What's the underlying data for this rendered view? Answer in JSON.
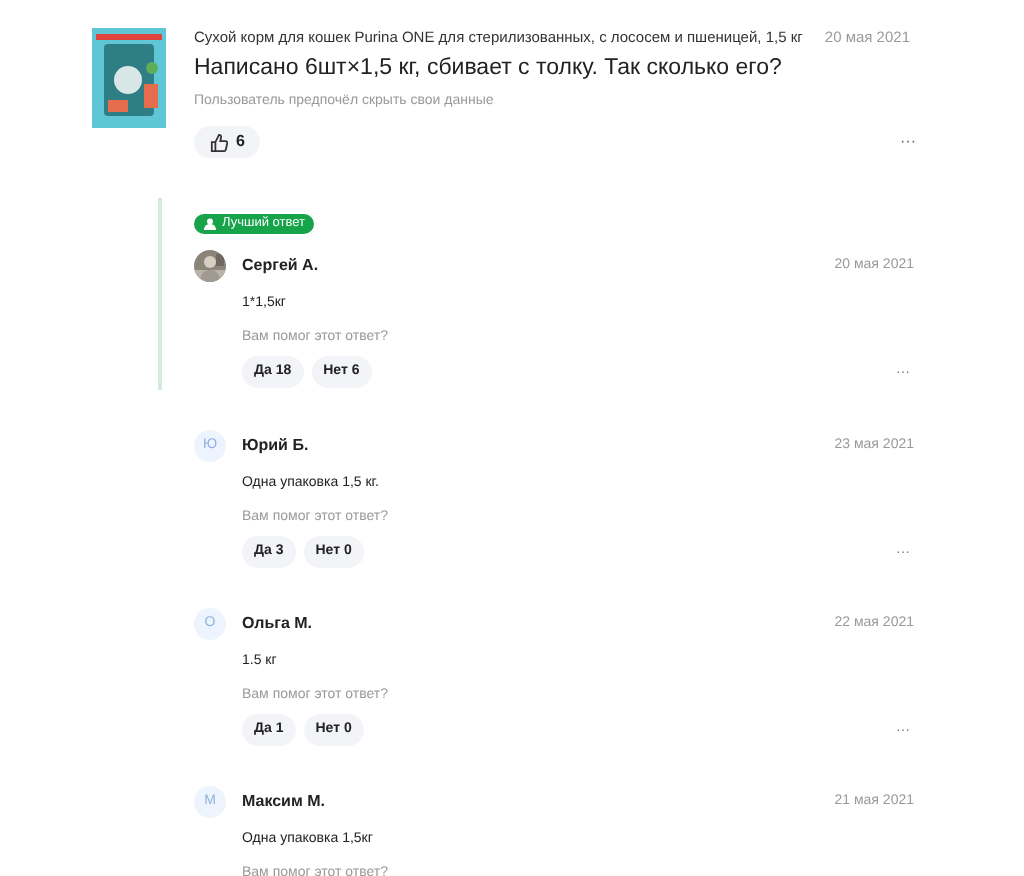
{
  "question": {
    "product": "Сухой корм для кошек Purina ONE для стерилизованных, с лососем и пшеницей, 1,5 кг",
    "date": "20 мая 2021",
    "title": "Написано 6шт×1,5 кг, сбивает с толку. Так сколько его?",
    "author_note": "Пользователь предпочёл скрыть свои данные",
    "likes": "6",
    "more": "···"
  },
  "answers": [
    {
      "best": true,
      "best_label": "Лучший ответ",
      "name": "Сергей А.",
      "date": "20 мая 2021",
      "text": "1*1,5кг",
      "help": "Вам помог этот ответ?",
      "yes": "Да 18",
      "no": "Нет 6",
      "more": "···"
    },
    {
      "best": false,
      "initial": "Ю",
      "name": "Юрий Б.",
      "date": "23 мая 2021",
      "text": "Одна упаковка 1,5 кг.",
      "help": "Вам помог этот ответ?",
      "yes": "Да 3",
      "no": "Нет 0",
      "more": "···"
    },
    {
      "best": false,
      "initial": "О",
      "name": "Ольга М.",
      "date": "22 мая 2021",
      "text": "1.5 кг",
      "help": "Вам помог этот ответ?",
      "yes": "Да 1",
      "no": "Нет 0",
      "more": "···"
    },
    {
      "best": false,
      "initial": "М",
      "name": "Максим М.",
      "date": "21 мая 2021",
      "text": "Одна упаковка 1,5кг",
      "help": "Вам помог этот ответ?"
    }
  ]
}
